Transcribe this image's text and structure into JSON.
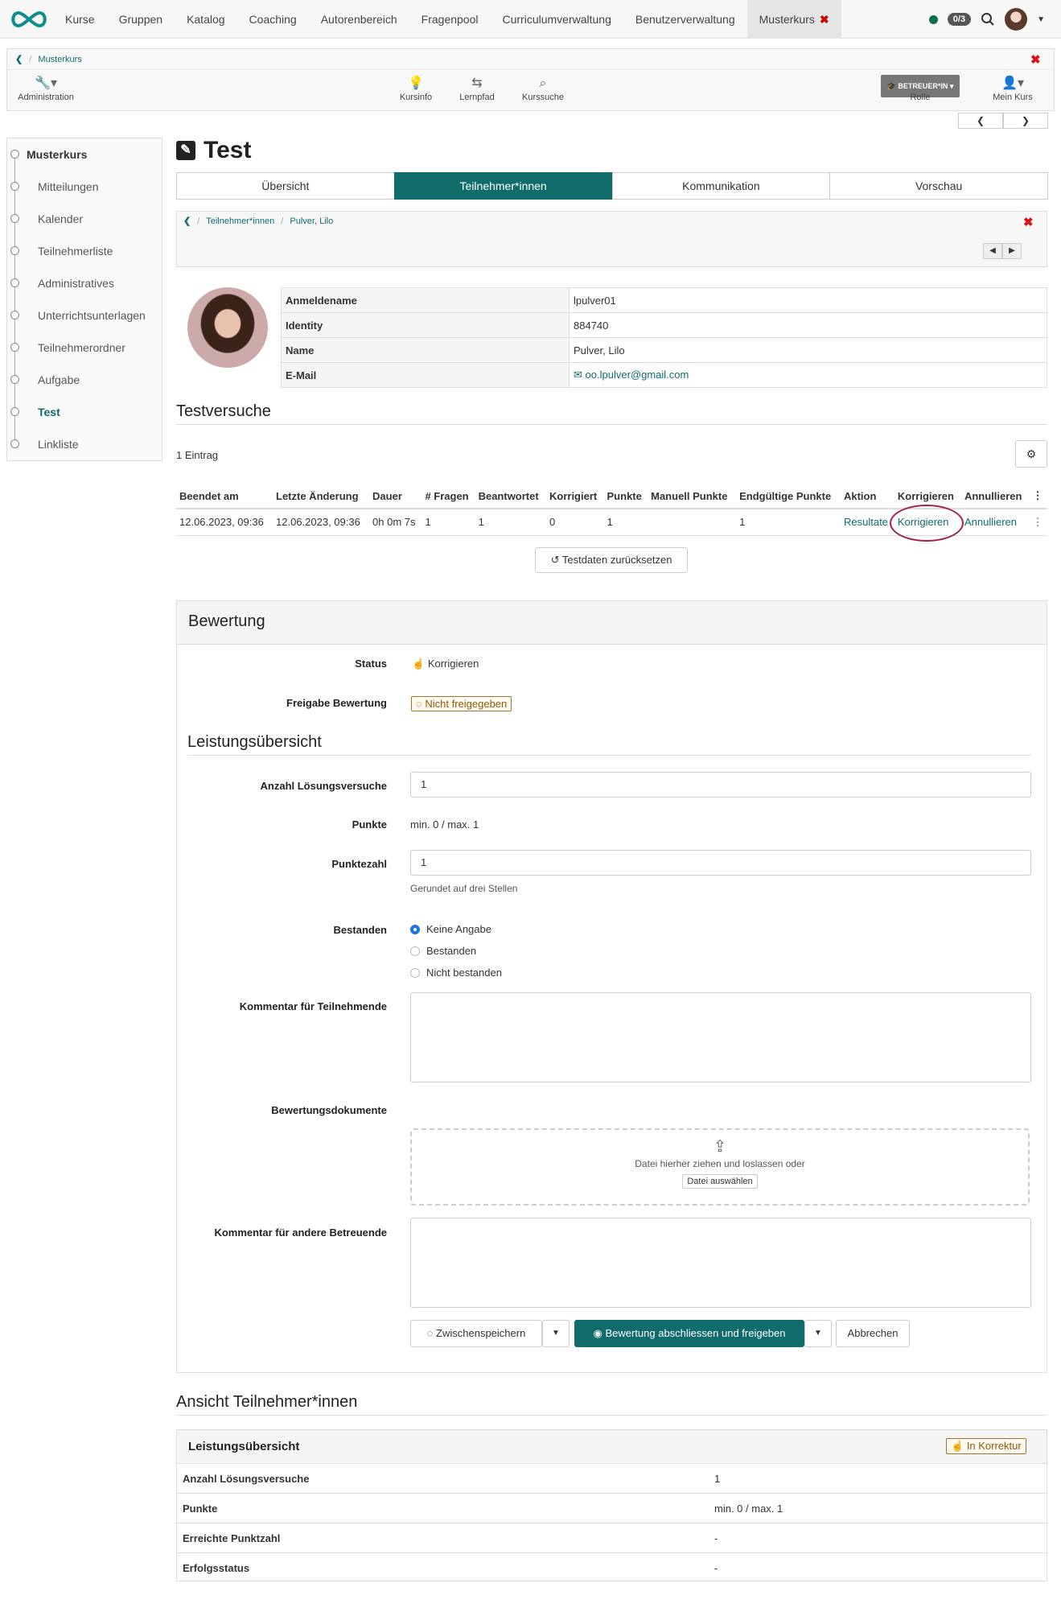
{
  "topnav": {
    "items": [
      "Kurse",
      "Gruppen",
      "Katalog",
      "Coaching",
      "Autorenbereich",
      "Fragenpool",
      "Curriculumverwaltung",
      "Benutzerverwaltung",
      "Musterkurs"
    ],
    "badge": "0/3"
  },
  "course_bar": {
    "breadcrumb": "Musterkurs",
    "admin": "Administration",
    "kursinfo": "Kursinfo",
    "lernpfad": "Lernpfad",
    "kurssuche": "Kurssuche",
    "role_button": "BETREUER*IN",
    "role_label": "Rolle",
    "mein_kurs": "Mein Kurs"
  },
  "sidebar": {
    "items": [
      "Musterkurs",
      "Mitteilungen",
      "Kalender",
      "Teilnehmerliste",
      "Administratives",
      "Unterrichtsunterlagen",
      "Teilnehmerordner",
      "Aufgabe",
      "Test",
      "Linkliste"
    ],
    "active": "Test"
  },
  "page": {
    "title": "Test",
    "tabs": [
      "Übersicht",
      "Teilnehmer*innen",
      "Kommunikation",
      "Vorschau"
    ],
    "active_tab": "Teilnehmer*innen",
    "breadcrumb": [
      "Teilnehmer*innen",
      "Pulver, Lilo"
    ]
  },
  "profile": {
    "rows": [
      {
        "label": "Anmeldename",
        "value": "lpulver01"
      },
      {
        "label": "Identity",
        "value": "884740"
      },
      {
        "label": "Name",
        "value": "Pulver, Lilo"
      },
      {
        "label": "E-Mail",
        "value": "oo.lpulver@gmail.com"
      }
    ]
  },
  "attempts": {
    "heading": "Testversuche",
    "count": "1 Eintrag",
    "headers": [
      "Beendet am",
      "Letzte Änderung",
      "Dauer",
      "# Fragen",
      "Beantwortet",
      "Korrigiert",
      "Punkte",
      "Manuell Punkte",
      "Endgültige Punkte",
      "Aktion",
      "Korrigieren",
      "Annullieren"
    ],
    "row": [
      "12.06.2023, 09:36",
      "12.06.2023, 09:36",
      "0h 0m 7s",
      "1",
      "1",
      "0",
      "1",
      "",
      "1",
      "Resultate",
      "Korrigieren",
      "Annullieren"
    ],
    "reset_button": "Testdaten zurücksetzen"
  },
  "assessment": {
    "heading": "Bewertung",
    "status_label": "Status",
    "status_value": "Korrigieren",
    "release_label": "Freigabe Bewertung",
    "release_value": "Nicht freigegeben",
    "overview_heading": "Leistungsübersicht",
    "attempts_label": "Anzahl Lösungsversuche",
    "attempts_value": "1",
    "points_label": "Punkte",
    "points_value": "min. 0 / max. 1",
    "score_label": "Punktezahl",
    "score_value": "1",
    "score_help": "Gerundet auf drei Stellen",
    "passed_label": "Bestanden",
    "passed_options": [
      "Keine Angabe",
      "Bestanden",
      "Nicht bestanden"
    ],
    "comment_label": "Kommentar für Teilnehmende",
    "docs_label": "Bewertungsdokumente",
    "drop_text": "Datei hierher ziehen und loslassen oder",
    "drop_button": "Datei auswählen",
    "coach_comment_label": "Kommentar für andere Betreuende",
    "save_button": "Zwischenspeichern",
    "finish_button": "Bewertung abschliessen und freigeben",
    "cancel_button": "Abbrechen"
  },
  "participant_view": {
    "heading": "Ansicht Teilnehmer*innen",
    "box_title": "Leistungsübersicht",
    "status_tag": "In Korrektur",
    "rows": [
      {
        "label": "Anzahl Lösungsversuche",
        "value": "1"
      },
      {
        "label": "Punkte",
        "value": "min. 0 / max. 1"
      },
      {
        "label": "Erreichte Punktzahl",
        "value": "-"
      },
      {
        "label": "Erfolgsstatus",
        "value": "-"
      }
    ]
  },
  "colors": {
    "accent": "#0f6c6b",
    "highlight_ellipse": "#a3204a",
    "close": "#d11111"
  }
}
